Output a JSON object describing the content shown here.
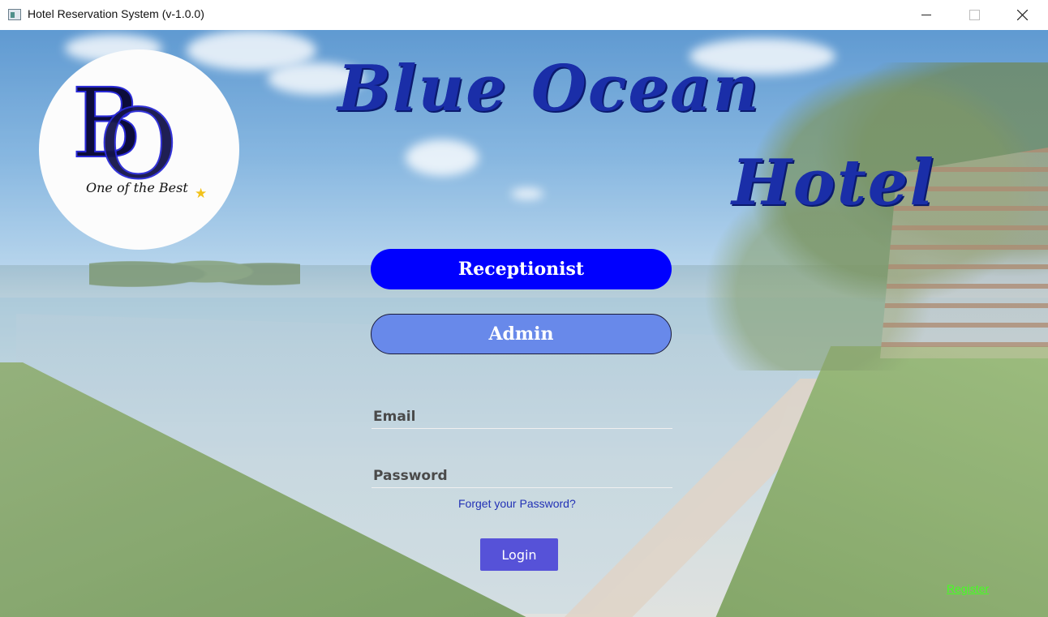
{
  "window": {
    "title": "Hotel Reservation System (v-1.0.0)"
  },
  "logo": {
    "monogram": "BO",
    "tagline": "One of the Best",
    "star_icon": "star-icon"
  },
  "header": {
    "line1": "Blue Ocean",
    "line2": "Hotel"
  },
  "roles": {
    "receptionist_label": "Receptionist",
    "admin_label": "Admin"
  },
  "form": {
    "email_placeholder": "Email",
    "password_placeholder": "Password",
    "forget_label": "Forget your Password?",
    "login_label": "Login"
  },
  "footer": {
    "register_label": "Register"
  },
  "colors": {
    "receptionist_button": "#0000ff",
    "admin_button": "#6889ea",
    "login_button": "#5652d8",
    "title_text": "#1a2ea8",
    "register_link": "#44ff22"
  }
}
